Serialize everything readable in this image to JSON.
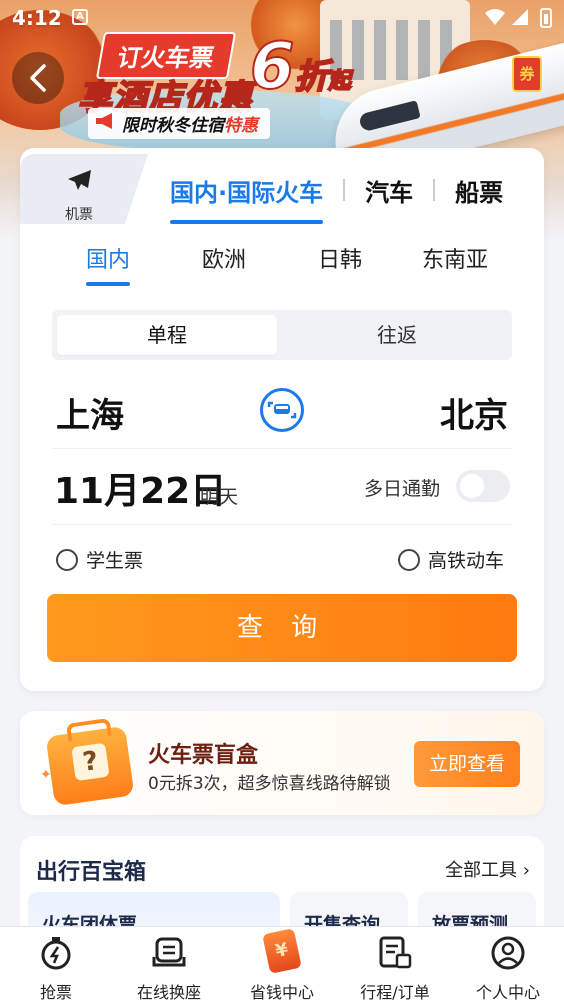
{
  "status_bar": {
    "time": "4:12",
    "app_icon_text": "A"
  },
  "banner": {
    "pill": "订火车票",
    "main": "享酒店优惠",
    "discount_number": "6",
    "discount_unit": "折",
    "discount_suffix": "起",
    "sub_prefix": "限时秋冬住宿",
    "sub_highlight": "特惠",
    "coupon": "券"
  },
  "tabs": {
    "flight": "机票",
    "train": "国内·国际火车",
    "bus": "汽车",
    "ship": "船票"
  },
  "regions": [
    "国内",
    "欧洲",
    "日韩",
    "东南亚"
  ],
  "trip_type": {
    "one_way": "单程",
    "round_trip": "往返"
  },
  "route": {
    "from": "上海",
    "to": "北京"
  },
  "date": {
    "value": "11月22日",
    "sub": "明天"
  },
  "multi_day_pass": {
    "label": "多日通勤",
    "enabled": false
  },
  "options": {
    "student": "学生票",
    "high_speed": "高铁动车"
  },
  "search_button": "查 询",
  "blind_box": {
    "title": "火车票盲盒",
    "subtitle": "0元拆3次，超多惊喜线路待解锁",
    "button": "立即查看"
  },
  "toolbox": {
    "title": "出行百宝箱",
    "more": "全部工具",
    "tools": [
      "火车团体票",
      "开售查询",
      "放票预测"
    ]
  },
  "bottom_nav": [
    "抢票",
    "在线换座",
    "省钱中心",
    "行程/订单",
    "个人中心"
  ],
  "colors": {
    "primary": "#1a7ae8",
    "accent": "#ff8a14"
  }
}
